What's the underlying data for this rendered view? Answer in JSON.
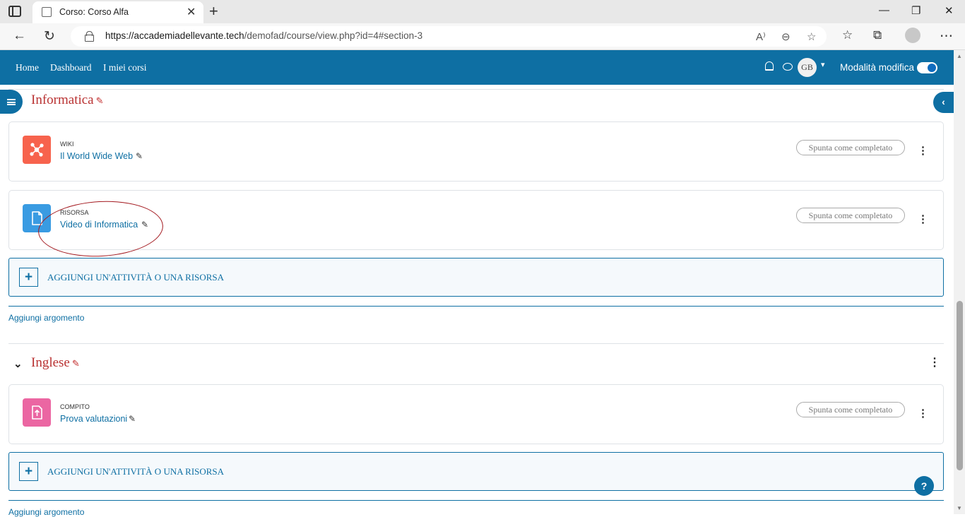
{
  "browser": {
    "tab_title": "Corso: Corso Alfa",
    "url_host": "https://accademiadellevante.tech",
    "url_path": "/demofad/course/view.php?id=4#section-3"
  },
  "navbar": {
    "links": [
      "Home",
      "Dashboard",
      "I miei corsi"
    ],
    "user_initials": "GB",
    "edit_mode_label": "Modalità modifica",
    "edit_mode_on": true
  },
  "sections": [
    {
      "title": "Informatica",
      "activities": [
        {
          "type": "WIKI",
          "name": "Il World Wide Web",
          "icon": "wiki-icon",
          "color": "#f7634d",
          "completion": "Spunta come completato"
        },
        {
          "type": "RISORSA",
          "name": "Video di Informatica",
          "icon": "file-icon",
          "color": "#399be2",
          "completion": "Spunta come completato"
        }
      ],
      "add_activity_label": "AGGIUNGI UN'ATTIVITÀ O UNA RISORSA",
      "add_topic_label": "Aggiungi argomento"
    },
    {
      "title": "Inglese",
      "activities": [
        {
          "type": "COMPITO",
          "name": "Prova valutazioni",
          "icon": "assignment-icon",
          "color": "#eb66a2",
          "completion": "Spunta come completato"
        }
      ],
      "add_activity_label": "AGGIUNGI UN'ATTIVITÀ O UNA RISORSA",
      "add_topic_label": "Aggiungi argomento"
    }
  ],
  "help_label": "?"
}
